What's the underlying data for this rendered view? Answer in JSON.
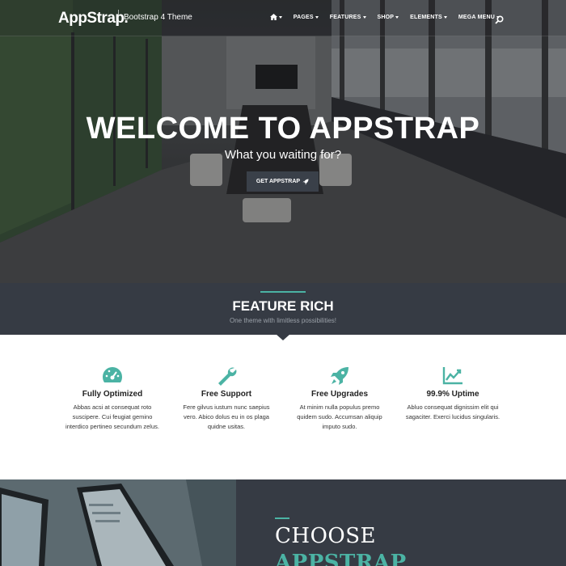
{
  "nav": {
    "logo": "AppStrap.",
    "tagline": "Bootstrap 4 Theme",
    "home_icon": "home-icon",
    "items": [
      {
        "label": "PAGES"
      },
      {
        "label": "FEATURES"
      },
      {
        "label": "SHOP"
      },
      {
        "label": "ELEMENTS"
      },
      {
        "label": "MEGA MENU"
      }
    ],
    "search_icon": "search-icon"
  },
  "hero": {
    "title": "WELCOME TO APPSTRAP",
    "subtitle": "What you waiting for?",
    "button_label": "GET APPSTRAP",
    "button_icon": "rocket-icon"
  },
  "band": {
    "title": "FEATURE RICH",
    "subtitle": "One theme with limitless possibilities!"
  },
  "features": [
    {
      "icon": "dashboard-icon",
      "title": "Fully Optimized",
      "desc": "Abbas acsi at consequat roto suscipere. Cui feugiat gemino interdico pertineo secundum zelus."
    },
    {
      "icon": "wrench-icon",
      "title": "Free Support",
      "desc": "Fere gilvus iustum nunc saepius vero. Abico dolus eu in os plaga quidne usitas."
    },
    {
      "icon": "rocket-icon",
      "title": "Free Upgrades",
      "desc": "At minim nulla populus premo quidem sudo. Accumsan aliquip imputo sudo."
    },
    {
      "icon": "chart-area-icon",
      "title": "99.9% Uptime",
      "desc": "Abluo consequat dignissim elit qui sagaciter. Exerci lucidus singularis."
    }
  ],
  "choose": {
    "title": "CHOOSE",
    "subtitle": "APPSTRAP"
  },
  "colors": {
    "accent": "#4bb3a4",
    "dark_band": "#363b44"
  }
}
